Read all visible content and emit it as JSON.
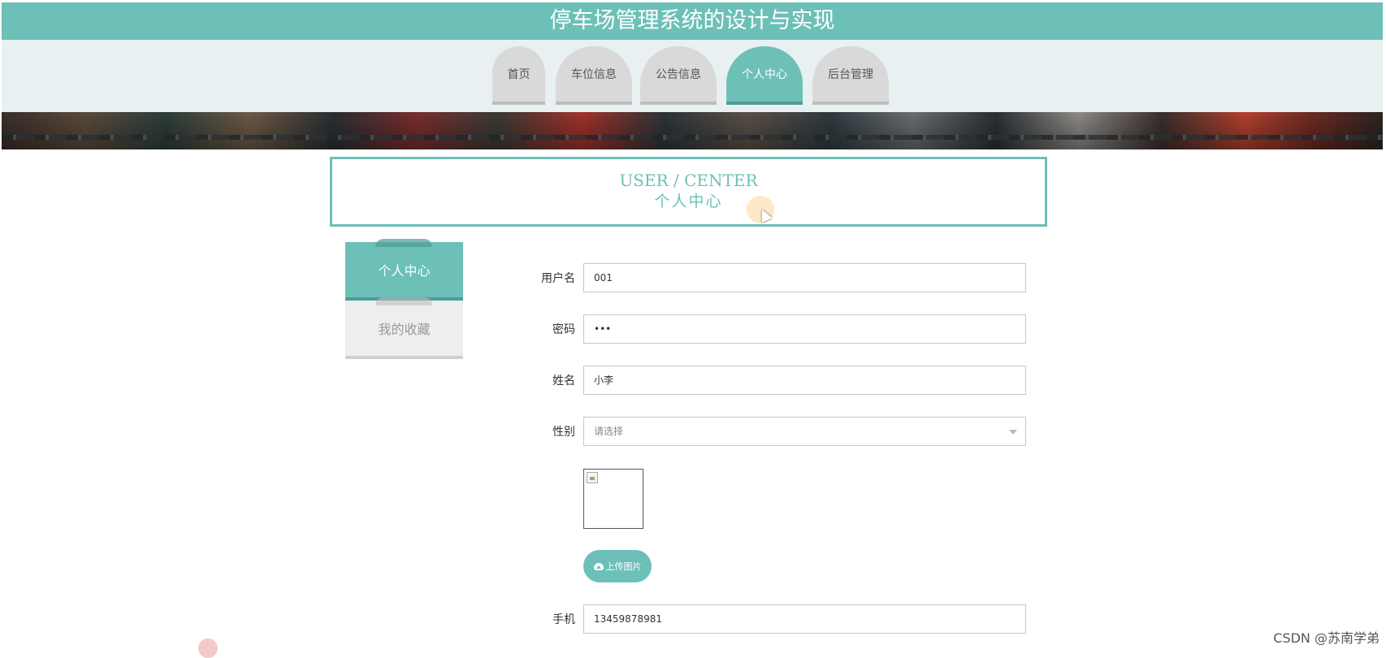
{
  "app": {
    "title": "停车场管理系统的设计与实现"
  },
  "nav": {
    "tabs": [
      {
        "label": "首页",
        "active": false
      },
      {
        "label": "车位信息",
        "active": false
      },
      {
        "label": "公告信息",
        "active": false
      },
      {
        "label": "个人中心",
        "active": true
      },
      {
        "label": "后台管理",
        "active": false
      }
    ]
  },
  "section": {
    "title_en": "USER / CENTER",
    "title_zh": "个人中心"
  },
  "side_menu": {
    "items": [
      {
        "label": "个人中心",
        "active": true
      },
      {
        "label": "我的收藏",
        "active": false
      }
    ]
  },
  "form": {
    "username": {
      "label": "用户名",
      "value": "001"
    },
    "password": {
      "label": "密码",
      "value": "•••"
    },
    "name": {
      "label": "姓名",
      "value": "小李"
    },
    "gender": {
      "label": "性别",
      "placeholder": "请选择"
    },
    "upload": {
      "label": "上传图片"
    },
    "phone": {
      "label": "手机",
      "value": "13459878981"
    }
  },
  "watermark": "CSDN @苏南学弟",
  "colors": {
    "accent": "#6cc0b8",
    "accent_dark": "#4e9c95",
    "nav_bg": "#e9f0f2"
  }
}
